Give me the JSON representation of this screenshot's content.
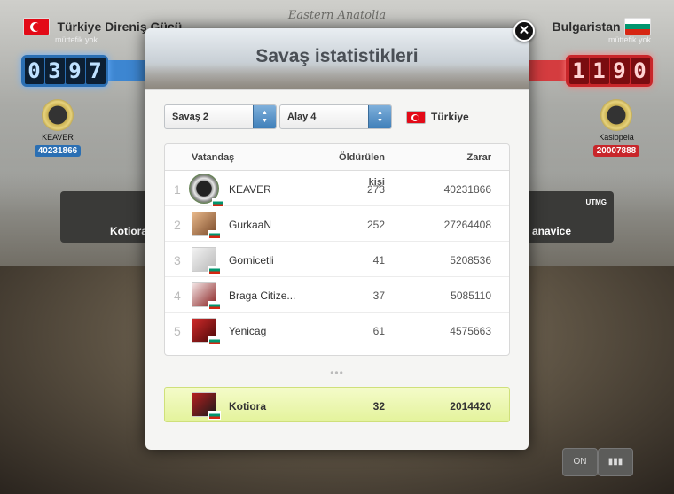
{
  "region": "Eastern Anatolia",
  "left_side": {
    "country": "Türkiye Direniş Gücü",
    "allies": "müttefik yok",
    "counter": [
      "0",
      "3",
      "9",
      "7"
    ],
    "hero_name": "KEAVER",
    "hero_value": "40231866"
  },
  "right_side": {
    "country": "Bulgaristan",
    "allies": "müttefik yok",
    "counter": [
      "1",
      "1",
      "9",
      "0"
    ],
    "hero_name": "Kasiopeia",
    "hero_value": "20007888"
  },
  "background_cards": {
    "left_label": "Kotiora",
    "right_label": "anavice",
    "right_badge": "UTMG"
  },
  "bottom_buttons": {
    "on_label": "ON"
  },
  "modal": {
    "title": "Savaş istatistikleri",
    "close_label": "✕",
    "battle_select": "Savaş 2",
    "round_select": "Alay 4",
    "country": "Türkiye",
    "columns": {
      "citizen": "Vatandaş",
      "kills": "Öldürülen",
      "damage": "Zarar"
    },
    "kills_unit": "kişi",
    "rows": [
      {
        "rank": "1",
        "name": "KEAVER",
        "kills": "273",
        "damage": "40231866"
      },
      {
        "rank": "2",
        "name": "GurkaaN",
        "kills": "252",
        "damage": "27264408"
      },
      {
        "rank": "3",
        "name": "Gornicetli",
        "kills": "41",
        "damage": "5208536"
      },
      {
        "rank": "4",
        "name": "Braga Citize...",
        "kills": "37",
        "damage": "5085110"
      },
      {
        "rank": "5",
        "name": "Yenicag",
        "kills": "61",
        "damage": "4575663"
      }
    ],
    "ellipsis": "•••",
    "self_row": {
      "name": "Kotiora",
      "kills": "32",
      "damage": "2014420"
    }
  },
  "colors": {
    "accent_blue": "#3f7fb9",
    "self_highlight": "#e4f39c",
    "turkey_red": "#e30a17"
  }
}
